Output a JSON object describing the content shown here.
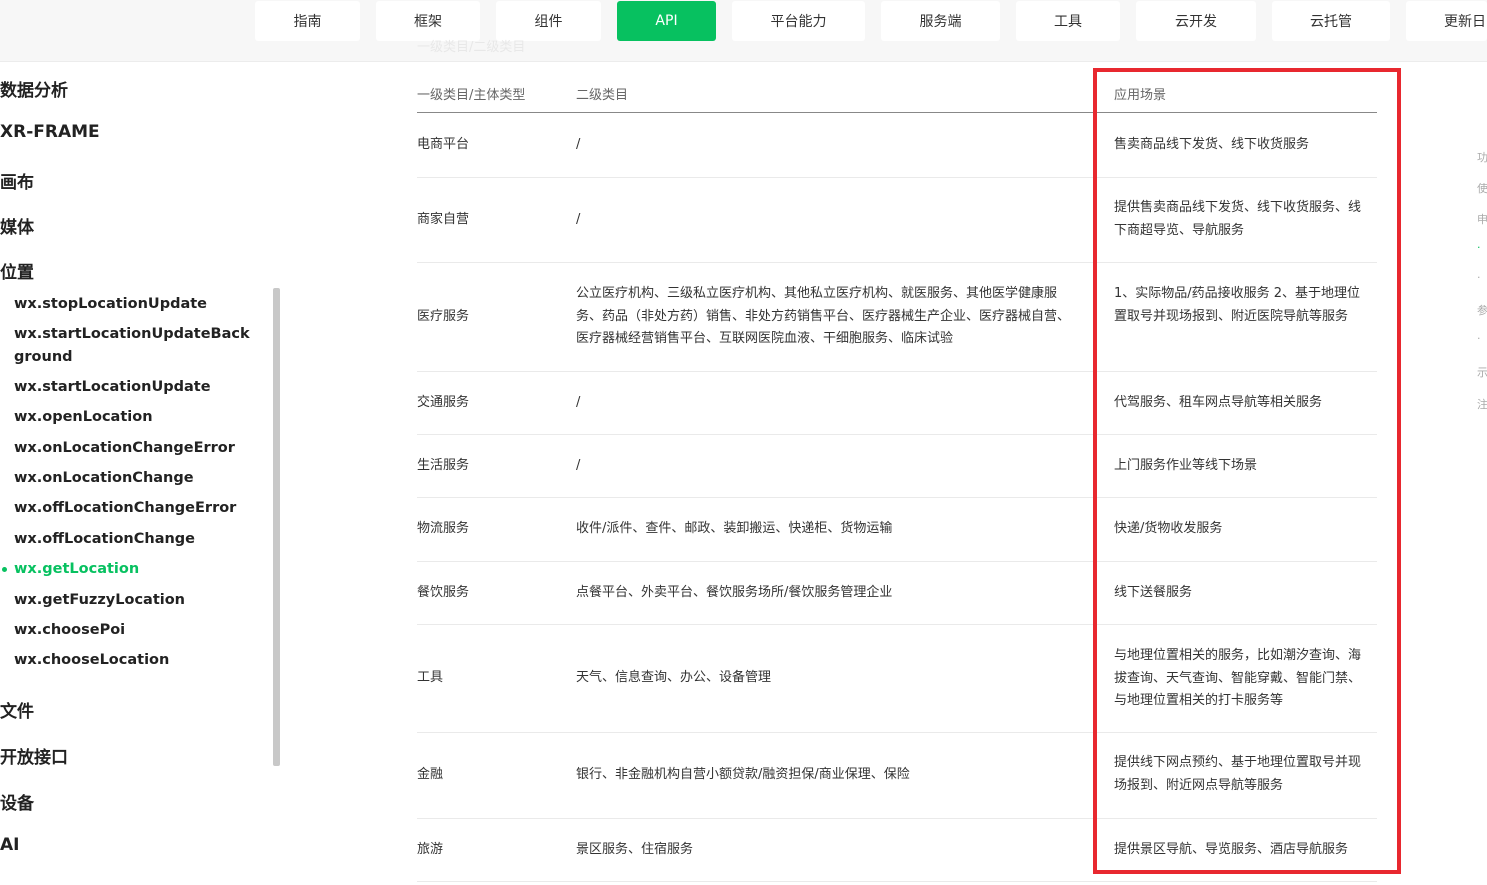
{
  "nav": {
    "tabs": [
      {
        "label": "指南",
        "active": false
      },
      {
        "label": "框架",
        "active": false
      },
      {
        "label": "组件",
        "active": false
      },
      {
        "label": "API",
        "active": true
      },
      {
        "label": "平台能力",
        "active": false
      },
      {
        "label": "服务端",
        "active": false
      },
      {
        "label": "工具",
        "active": false
      },
      {
        "label": "云开发",
        "active": false
      },
      {
        "label": "云托管",
        "active": false
      },
      {
        "label": "更新日",
        "active": false
      }
    ],
    "faint_crumb": "一级类目/二级类目"
  },
  "sidebar": {
    "sections_top": [
      "数据分析",
      "XR-FRAME",
      "画布",
      "媒体",
      "位置"
    ],
    "location_items": [
      "wx.stopLocationUpdate",
      "wx.startLocationUpdateBackground",
      "wx.startLocationUpdate",
      "wx.openLocation",
      "wx.onLocationChangeError",
      "wx.onLocationChange",
      "wx.offLocationChangeError",
      "wx.offLocationChange",
      "wx.getLocation",
      "wx.getFuzzyLocation",
      "wx.choosePoi",
      "wx.chooseLocation"
    ],
    "active_item": "wx.getLocation",
    "sections_bottom": [
      "文件",
      "开放接口",
      "设备",
      "AI"
    ]
  },
  "table": {
    "headers": [
      "一级类目/主体类型",
      "二级类目",
      "应用场景"
    ],
    "rows": [
      {
        "primary": "电商平台",
        "secondary": "/",
        "scenario": "售卖商品线下发货、线下收货服务"
      },
      {
        "primary": "商家自营",
        "secondary": "/",
        "scenario": "提供售卖商品线下发货、线下收货服务、线下商超导览、导航服务"
      },
      {
        "primary": "医疗服务",
        "secondary": "公立医疗机构、三级私立医疗机构、其他私立医疗机构、就医服务、其他医学健康服务、药品（非处方药）销售、非处方药销售平台、医疗器械生产企业、医疗器械自营、医疗器械经营销售平台、互联网医院血液、干细胞服务、临床试验",
        "scenario": "1、实际物品/药品接收服务 2、基于地理位置取号并现场报到、附近医院导航等服务"
      },
      {
        "primary": "交通服务",
        "secondary": "/",
        "scenario": "代驾服务、租车网点导航等相关服务"
      },
      {
        "primary": "生活服务",
        "secondary": "/",
        "scenario": "上门服务作业等线下场景"
      },
      {
        "primary": "物流服务",
        "secondary": "收件/派件、查件、邮政、装卸搬运、快递柜、货物运输",
        "scenario": "快递/货物收发服务"
      },
      {
        "primary": "餐饮服务",
        "secondary": "点餐平台、外卖平台、餐饮服务场所/餐饮服务管理企业",
        "scenario": "线下送餐服务"
      },
      {
        "primary": "工具",
        "secondary": "天气、信息查询、办公、设备管理",
        "scenario": "与地理位置相关的服务，比如潮汐查询、海拔查询、天气查询、智能穿戴、智能门禁、与地理位置相关的打卡服务等"
      },
      {
        "primary": "金融",
        "secondary": "银行、非金融机构自营小额贷款/融资担保/商业保理、保险",
        "scenario": "提供线下网点预约、基于地理位置取号并现场报到、附近网点导航等服务"
      },
      {
        "primary": "旅游",
        "secondary": "景区服务、住宿服务",
        "scenario": "提供景区导航、导览服务、酒店导航服务"
      }
    ]
  },
  "toc_fragments": [
    "功",
    "使",
    "申",
    "·",
    "·",
    "参",
    "·",
    "示",
    "注"
  ],
  "colors": {
    "accent": "#07c160",
    "highlight_border": "#e8282f"
  }
}
